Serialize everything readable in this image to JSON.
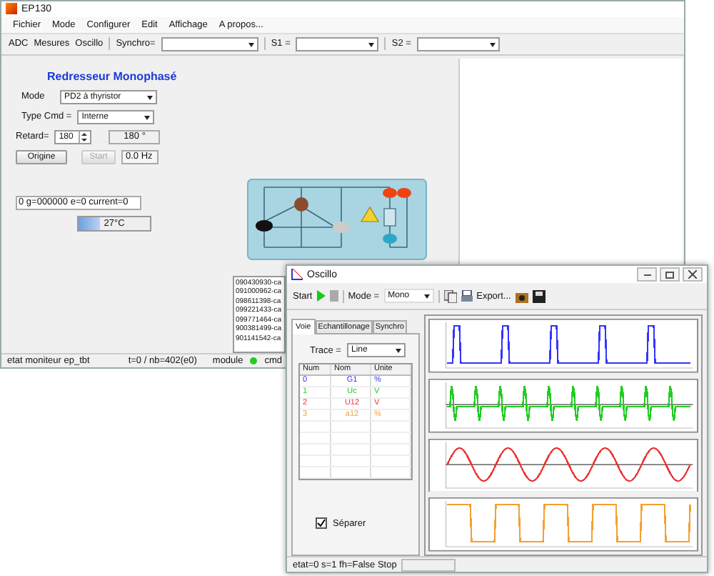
{
  "main_window": {
    "title": "EP130",
    "menu": [
      "Fichier",
      "Mode",
      "Configurer",
      "Edit",
      "Affichage",
      "A propos..."
    ],
    "toolbar": {
      "buttons": [
        "ADC",
        "Mesures",
        "Oscillo"
      ],
      "synchro_label": "Synchro=",
      "s1_label": "S1 =",
      "s2_label": "S2 ="
    },
    "panel": {
      "title": "Redresseur Monophasé",
      "mode_label": "Mode",
      "mode_value": "PD2 à thyristor",
      "type_cmd_label": "Type Cmd =",
      "type_cmd_value": "Interne",
      "retard_label": "Retard=",
      "retard_value": "180",
      "angle": "180 °",
      "origine_button": "Origine",
      "start_button": {
        "label": "Start",
        "disabled": true
      },
      "frequency": "0.0 Hz",
      "status_field": "0 g=000000 e=0 current=0",
      "temperature": {
        "reading": "27°C",
        "level": 0.3
      }
    },
    "log": [
      "090430930-ca",
      "091000962-ca",
      "098611398-ca",
      "099221433-ca",
      "099771464-ca",
      "900381499-ca",
      "901141542-ca"
    ],
    "status_bar": {
      "state": "etat moniteur ep_tbt",
      "counter": "t=0 / nb=402(e0)",
      "module": "module",
      "cmd": {
        "label": "cmd",
        "on": true
      }
    }
  },
  "oscillo": {
    "title": "Oscillo",
    "toolbar": {
      "start": "Start",
      "mode_label": "Mode =",
      "mode_value": "Mono",
      "export": "Export..."
    },
    "tabs": [
      {
        "label": "Voie",
        "selected": true
      },
      {
        "label": "Echantillonage",
        "selected": false
      },
      {
        "label": "Synchro",
        "selected": false
      }
    ],
    "trace_label": "Trace =",
    "trace_value": "Line",
    "table": {
      "columns": [
        "Num",
        "Nom",
        "Unite"
      ],
      "rows": [
        {
          "num": "0",
          "nom": "G1",
          "unite": "%",
          "color": "#3333ff"
        },
        {
          "num": "1",
          "nom": "Uc",
          "unite": "V",
          "color": "#22cc22"
        },
        {
          "num": "2",
          "nom": "U12",
          "unite": "V",
          "color": "#ee3333"
        },
        {
          "num": "3",
          "nom": "a12",
          "unite": "%",
          "color": "#f5a030"
        }
      ]
    },
    "separate": {
      "label": "Séparer",
      "checked": true
    },
    "status": "etat=0 s=1 fh=False Stop"
  }
}
